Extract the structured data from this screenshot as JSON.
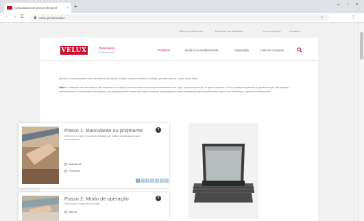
{
  "browser": {
    "tab_title": "Calculadora de preços de janel",
    "tab_close": "×",
    "new_tab": "+",
    "url": "velux.pt/calculador",
    "window_controls": [
      "–",
      "▫",
      "×"
    ],
    "nav_icons": [
      "←",
      "→",
      "C"
    ]
  },
  "utility_nav": [
    "Área de profissional",
    "Encontrar um instalador",
    "A sua empresa",
    "Contacto"
  ],
  "header": {
    "logo": "VELUX",
    "brand_name": "Particulares",
    "brand_sub": "Profissionais",
    "nav": [
      {
        "label": "Produtos",
        "active": true
      },
      {
        "label": "Ajuda e aconselhamento",
        "active": false
      },
      {
        "label": "Inspiração",
        "active": false
      },
      {
        "label": "Lista de compras",
        "active": false
      }
    ]
  },
  "intro_text": "Ajuda-lo o rapidamente uma calculadora de preços. Utilize-a para encontrar a solução perfeita para si e para a sua casa.",
  "note": {
    "label": "Nota:",
    "text": "a utilização da calculadora não dispensa a consulta da nossa tabela de preços actualmente em vigor, cujos preços são os que se aplicam. Para produtos especiais ou produtos que não estejam mencionados no nosso tabela de preços, os preços poderão variar, pelo que os preços apresentados nesta calculadora são considerados como uma referência, sujeitos a confirmação."
  },
  "step1": {
    "title": "Passo 1: Basculante ou projetante",
    "help": "?",
    "description": "Seleccione o tipo de janela de telhado que melhor se adequa às suas necessidades.",
    "options": [
      "Basculante",
      "Projetante"
    ],
    "pager": [
      "1",
      "2",
      "3",
      "4",
      "5",
      "6",
      "7"
    ]
  },
  "step2": {
    "title": "Passo 2: Modo de operação",
    "help": "?",
    "description": "Seleccione o modo de operação.",
    "options": [
      "Manual"
    ]
  },
  "colors": {
    "brand_red": "#c8102e",
    "pager_blue": "#b3c9db"
  }
}
